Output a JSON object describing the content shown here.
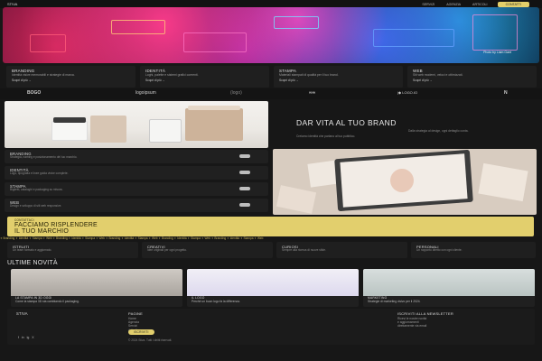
{
  "header": {
    "brand": "STIVA",
    "nav": [
      "SERVIZI",
      "AGENZIA",
      "ARTICOLI"
    ],
    "cta": "CONTATTI"
  },
  "hero": {
    "credit": "Photo by Liam Gant"
  },
  "top_services": [
    {
      "title": "BRANDING",
      "desc": "Identità visive memorabili e strategie di marca.",
      "link": "Scopri di più →"
    },
    {
      "title": "IDENTITÀ",
      "desc": "Loghi, palette e sistemi grafici coerenti.",
      "link": "Scopri di più →"
    },
    {
      "title": "STAMPA",
      "desc": "Materiali stampati di qualità per il tuo brand.",
      "link": "Scopri di più →"
    },
    {
      "title": "WEB",
      "desc": "Siti web moderni, veloci e ottimizzati.",
      "link": "Scopri di più →"
    }
  ],
  "logos": [
    "BOGO",
    "logoipsum",
    "(logo)",
    "∞∞",
    "|◆ LOGO.IO",
    "N"
  ],
  "brand_section": {
    "title": "DAR VITA AL TUO BRAND",
    "text_left": "Creiamo identità che parlano al tuo pubblico.",
    "text_right": "Dalla strategia al design, ogni dettaglio conta."
  },
  "services": [
    {
      "title": "BRANDING",
      "desc": "Strategia, naming e posizionamento del tuo marchio."
    },
    {
      "title": "IDENTITÀ",
      "desc": "Logo, tipografia e linee guida visive complete."
    },
    {
      "title": "STAMPA",
      "desc": "Biglietti, cataloghi e packaging su misura."
    },
    {
      "title": "WEB",
      "desc": "Design e sviluppo di siti web responsive."
    }
  ],
  "banner": {
    "kicker": "CONTATTACI",
    "title_1": "FACCIAMO RISPLENDERE",
    "title_2": "IL TUO MARCHIO"
  },
  "marquee": "✦ Branding ✦ Identità ✦ Stampa ✦ Web ✦ Branding ✦ Identità ✦ Stampa ✦ Web ✦ Branding ✦ Identità ✦ Stampa ✦ Web ✦ Branding ✦ Identità ✦ Stampa ✦ Web ✦ Branding ✦ Identità ✦ Stampa ✦ Web",
  "features": [
    {
      "title": "ISTRUITI",
      "desc": "Un team formato e aggiornato."
    },
    {
      "title": "CREATIVI",
      "desc": "Idee originali per ogni progetto."
    },
    {
      "title": "CURIOSI",
      "desc": "Sempre alla ricerca di nuove sfide."
    },
    {
      "title": "PERSONALI",
      "desc": "Un rapporto diretto con ogni cliente."
    }
  ],
  "news": {
    "title": "ULTIME NOVITÀ",
    "posts": [
      {
        "tag": "LA STAMPA IN 3D OGGI",
        "text": "Come la stampa 3D sta cambiando il packaging."
      },
      {
        "tag": "IL LOGO",
        "text": "Perché un buon logo fa la differenza."
      },
      {
        "tag": "MARKETING",
        "text": "Strategie di marketing visivo per il 2024."
      }
    ]
  },
  "footer": {
    "brand": "STIVA",
    "col1_title": "PAGINE",
    "col1": [
      "Home",
      "Agenzia",
      "Servizi",
      "Articoli"
    ],
    "col2_title": "ISCRIVITI ALLA NEWSLETTER",
    "col2": [
      "Ricevi le nostre novità",
      "e aggiornamenti",
      "direttamente via email"
    ],
    "subscribe": "ISCRIVITI",
    "social": [
      "f",
      "in",
      "ig",
      "X"
    ],
    "copyright": "© 2024 Stiva. Tutti i diritti riservati."
  }
}
